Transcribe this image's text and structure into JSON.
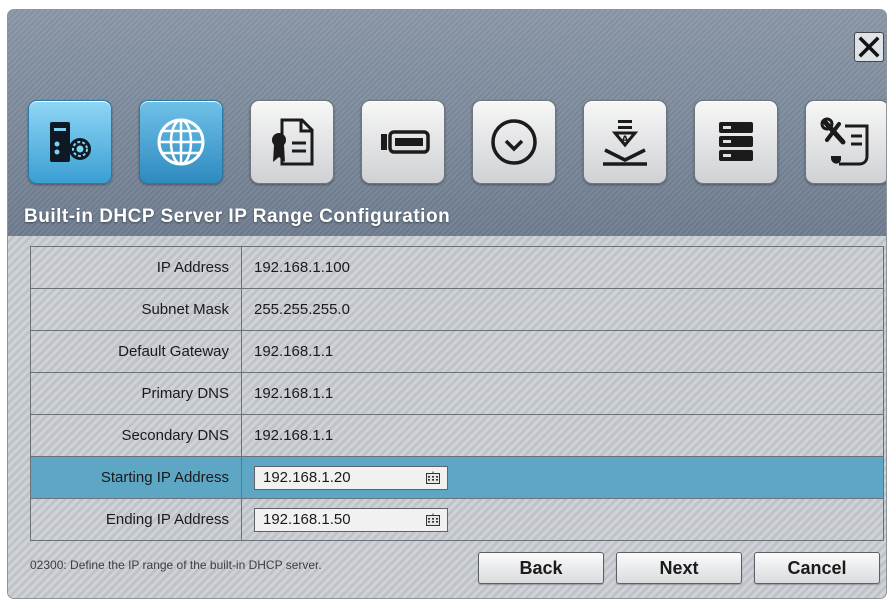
{
  "window": {
    "title": "Built-in DHCP Server IP Range Configuration"
  },
  "toolbar": [
    {
      "icon": "server-settings-icon",
      "state": "active"
    },
    {
      "icon": "globe-icon",
      "state": "current"
    },
    {
      "icon": "certificate-icon",
      "state": "normal"
    },
    {
      "icon": "storage-device-icon",
      "state": "normal"
    },
    {
      "icon": "clock-icon",
      "state": "normal"
    },
    {
      "icon": "download-tray-icon",
      "state": "normal"
    },
    {
      "icon": "stacked-storage-icon",
      "state": "normal"
    },
    {
      "icon": "tools-scroll-icon",
      "state": "normal"
    }
  ],
  "rows": [
    {
      "label": "IP Address",
      "value": "192.168.1.100"
    },
    {
      "label": "Subnet Mask",
      "value": "255.255.255.0"
    },
    {
      "label": "Default Gateway",
      "value": "192.168.1.1"
    },
    {
      "label": "Primary DNS",
      "value": "192.168.1.1"
    },
    {
      "label": "Secondary DNS",
      "value": "192.168.1.1"
    }
  ],
  "range": {
    "start_label": "Starting IP Address",
    "start_value": "192.168.1.20",
    "end_label": "Ending IP Address",
    "end_value": "192.168.1.50"
  },
  "hint": "02300: Define the IP range of the built-in DHCP server.",
  "buttons": {
    "back": "Back",
    "next": "Next",
    "cancel": "Cancel"
  },
  "colors": {
    "header": "#7a8799",
    "highlight_row": "#5da7c4",
    "active_tab": "#3a9fd3"
  }
}
